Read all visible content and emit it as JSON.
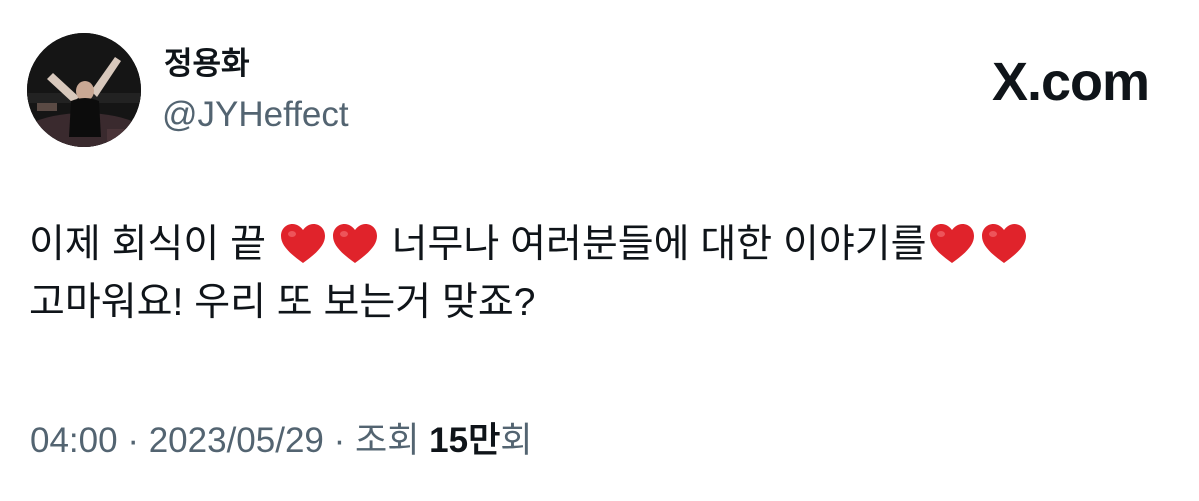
{
  "author": {
    "display_name": "정용화",
    "handle": "@JYHeffect"
  },
  "brand": {
    "logo_text": "X.com"
  },
  "tweet": {
    "line1": {
      "part1": "이제 회식이 끝",
      "part2": "너무나 여러분들에 대한 이야기를"
    },
    "line2": "고마워요! 우리 또 보는거 맞죠?",
    "heart_icon": "red-heart-icon",
    "heart_color": "#e0232b"
  },
  "meta": {
    "time": "04:00",
    "separator": "·",
    "date": "2023/05/29",
    "views_label": "조회",
    "views_count": "15만",
    "views_suffix": "회"
  },
  "colors": {
    "text_primary": "#0f1419",
    "text_secondary": "#536471"
  }
}
